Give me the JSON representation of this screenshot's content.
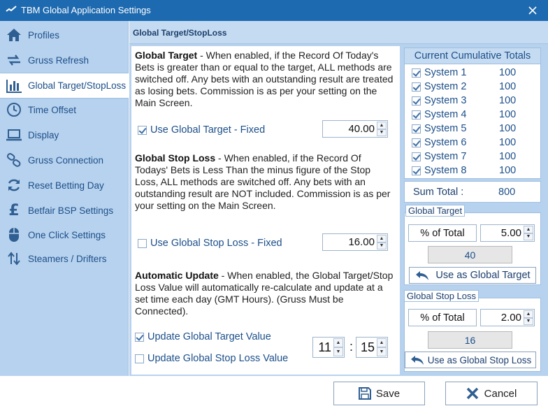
{
  "window": {
    "title": "TBM Global Application Settings"
  },
  "sidebar": {
    "items": [
      {
        "label": "Profiles",
        "icon": "home-icon"
      },
      {
        "label": "Gruss Refresh",
        "icon": "refresh-arrows-icon"
      },
      {
        "label": "Global Target/StopLoss",
        "icon": "bar-chart-icon"
      },
      {
        "label": "Time Offset",
        "icon": "clock-icon"
      },
      {
        "label": "Display",
        "icon": "laptop-icon"
      },
      {
        "label": "Gruss Connection",
        "icon": "link-icon"
      },
      {
        "label": "Reset Betting Day",
        "icon": "reload-icon"
      },
      {
        "label": "Betfair BSP Settings",
        "icon": "pound-icon"
      },
      {
        "label": "One Click Settings",
        "icon": "mouse-icon"
      },
      {
        "label": "Steamers / Drifters",
        "icon": "up-down-arrows-icon"
      }
    ],
    "active_index": 2
  },
  "main": {
    "header": "Global Target/StopLoss",
    "global_target": {
      "heading": "Global Target",
      "text": " - When enabled,  if the Record Of Today's Bets is greater than or equal to the target, ALL methods are switched off. Any bets with an outstanding result are treated as losing bets. Commission is as per your setting  on the Main Screen.",
      "checkbox_label": "Use Global Target - Fixed",
      "checked": true,
      "value": "40.00"
    },
    "global_stop_loss": {
      "heading": "Global Stop Loss",
      "text": " - When enabled,  if the Record Of Todays' Bets is Less Than the minus figure of the Stop Loss, ALL methods are switched off. Any bets with an outstanding  result are NOT included.  Commission is as per your setting  on the Main Screen.",
      "checkbox_label": "Use Global Stop Loss - Fixed",
      "checked": false,
      "value": "16.00"
    },
    "auto_update": {
      "heading": "Automatic Update",
      "text": " - When enabled, the Global Target/Stop Loss Value will automatically re-calculate and update at a set time each day (GMT Hours). (Gruss Must be Connected).",
      "update_target_label": "Update Global Target Value",
      "update_target_checked": true,
      "update_stop_label": "Update Global Stop Loss Value",
      "update_stop_checked": false,
      "hour": "11",
      "separator": ":",
      "minute": "15"
    },
    "totals": {
      "title": "Current Cumulative Totals",
      "systems": [
        {
          "name": "System 1",
          "value": "100",
          "checked": true
        },
        {
          "name": "System 2",
          "value": "100",
          "checked": true
        },
        {
          "name": "System 3",
          "value": "100",
          "checked": true
        },
        {
          "name": "System 4",
          "value": "100",
          "checked": true
        },
        {
          "name": "System 5",
          "value": "100",
          "checked": true
        },
        {
          "name": "System 6",
          "value": "100",
          "checked": true
        },
        {
          "name": "System 7",
          "value": "100",
          "checked": true
        },
        {
          "name": "System 8",
          "value": "100",
          "checked": true
        }
      ],
      "sum_label": "Sum Total :",
      "sum_value": "800"
    },
    "target_group": {
      "title": "Global Target",
      "pct_label": "% of Total",
      "pct_value": "5.00",
      "result": "40",
      "button": "Use as Global Target"
    },
    "stop_group": {
      "title": "Global Stop Loss",
      "pct_label": "% of Total",
      "pct_value": "2.00",
      "result": "16",
      "button": "Use as Global Stop Loss"
    }
  },
  "footer": {
    "save_label": "Save",
    "cancel_label": "Cancel"
  },
  "colors": {
    "titlebar": "#1e6ab0",
    "sidebar": "#b7d2ee",
    "accent_text": "#1c4f8a"
  }
}
